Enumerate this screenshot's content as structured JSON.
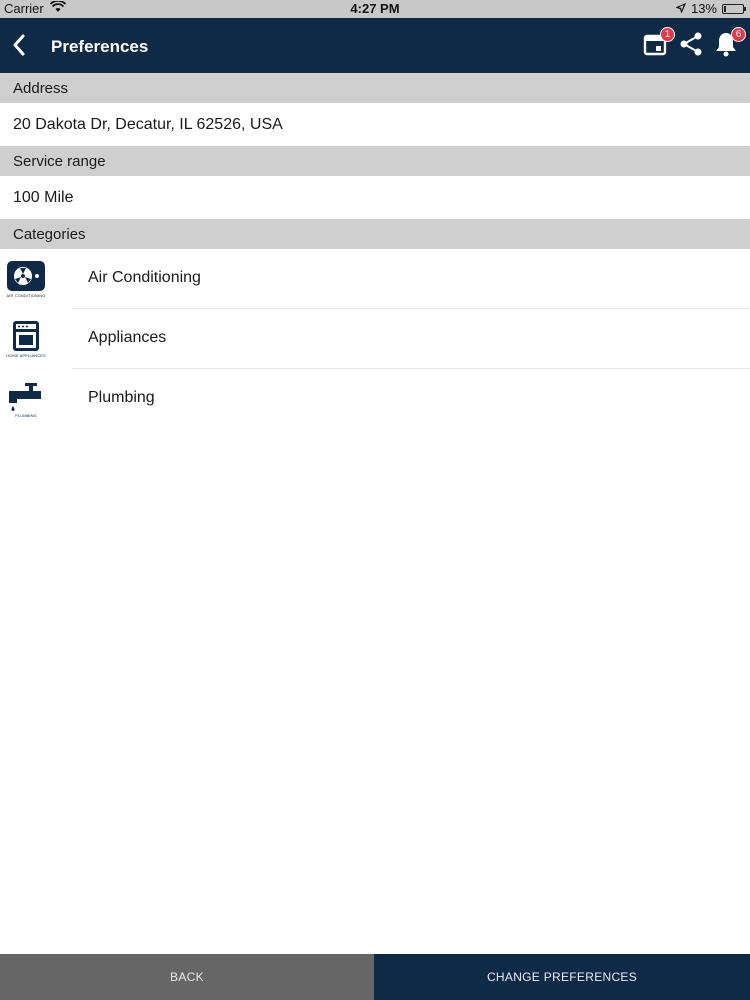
{
  "status_bar": {
    "carrier": "Carrier",
    "time": "4:27 PM",
    "battery_percent": "13%",
    "battery_level": 0.13
  },
  "nav": {
    "title": "Preferences",
    "calendar_badge": "1",
    "notifications_badge": "6"
  },
  "address": {
    "header": "Address",
    "value": "20 Dakota Dr, Decatur, IL 62526, USA"
  },
  "service_range": {
    "header": "Service range",
    "value": "100 Mile"
  },
  "categories": {
    "header": "Categories",
    "items": [
      {
        "label": "Air Conditioning",
        "icon": "air-conditioning-icon",
        "caption": "AIR CONDITIONING"
      },
      {
        "label": "Appliances",
        "icon": "appliances-icon",
        "caption": "HOME APPLIANCES"
      },
      {
        "label": "Plumbing",
        "icon": "plumbing-icon",
        "caption": "PLUMBING"
      }
    ]
  },
  "bottom": {
    "back_label": "BACK",
    "change_label": "CHANGE PREFERENCES"
  },
  "colors": {
    "nav_bg": "#0f2a47",
    "section_bg": "#cfcfcf",
    "badge": "#e5384a",
    "back_button_bg": "#666666"
  }
}
